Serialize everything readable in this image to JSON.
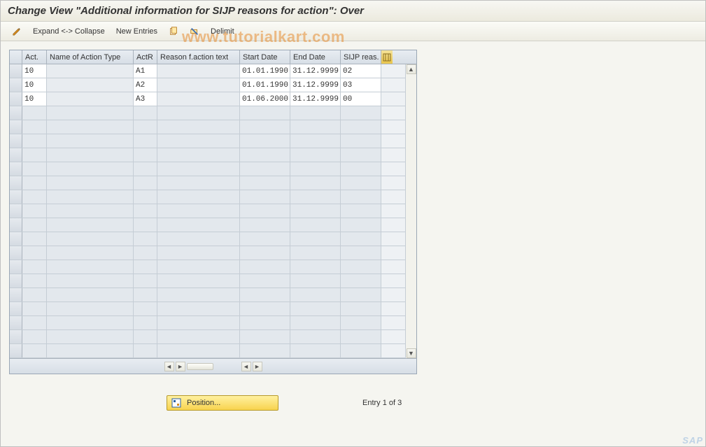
{
  "title": "Change View \"Additional information for SIJP reasons for action\": Over",
  "watermark": "www.tutorialkart.com",
  "toolbar": {
    "expand_collapse": "Expand <-> Collapse",
    "new_entries": "New Entries",
    "delimit": "Delimit"
  },
  "columns": {
    "act": "Act.",
    "name": "Name of Action Type",
    "actr": "ActR",
    "reason": "Reason f.action text",
    "start": "Start Date",
    "end": "End Date",
    "sijp": "SIJP reas."
  },
  "rows": [
    {
      "act": "10",
      "name": "",
      "actr": "A1",
      "reason": "",
      "start": "01.01.1990",
      "end": "31.12.9999",
      "sijp": "02"
    },
    {
      "act": "10",
      "name": "",
      "actr": "A2",
      "reason": "",
      "start": "01.01.1990",
      "end": "31.12.9999",
      "sijp": "03"
    },
    {
      "act": "10",
      "name": "",
      "actr": "A3",
      "reason": "",
      "start": "01.06.2000",
      "end": "31.12.9999",
      "sijp": "00"
    }
  ],
  "empty_row_count": 18,
  "footer": {
    "position_label": "Position...",
    "entry_text": "Entry 1 of 3"
  },
  "sap_badge": "SAP"
}
